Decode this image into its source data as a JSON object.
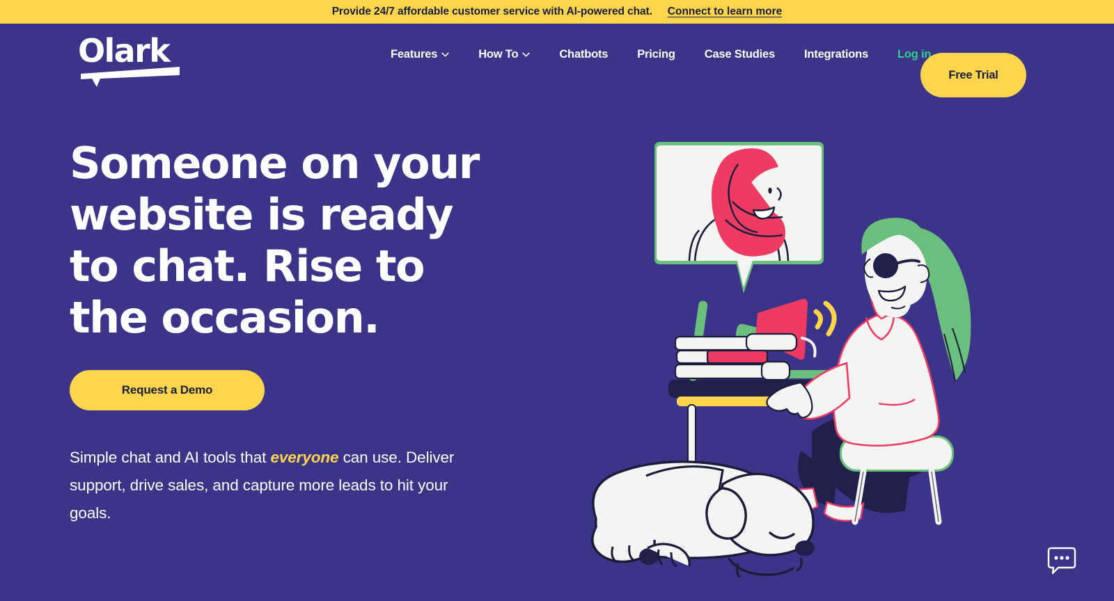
{
  "colors": {
    "background": "#3b3488",
    "accent_yellow": "#ffd54d",
    "link_green": "#2fd18a",
    "dark_navy": "#1b1b3a",
    "illus_green": "#6bbf7c",
    "illus_pink": "#ee3b63",
    "illus_white": "#f4f4f2"
  },
  "banner": {
    "message": "Provide 24/7 affordable customer service with AI-powered chat.",
    "link_label": "Connect to learn more"
  },
  "header": {
    "logo_text": "Olark",
    "nav_items": [
      {
        "label": "Features",
        "has_dropdown": true,
        "icon": "chevron-down-icon"
      },
      {
        "label": "How To",
        "has_dropdown": true,
        "icon": "chevron-down-icon"
      },
      {
        "label": "Chatbots",
        "has_dropdown": false
      },
      {
        "label": "Pricing",
        "has_dropdown": false
      },
      {
        "label": "Case Studies",
        "has_dropdown": false
      },
      {
        "label": "Integrations",
        "has_dropdown": false
      }
    ],
    "login_label": "Log in",
    "free_trial_label": "Free Trial"
  },
  "hero": {
    "headline": "Someone on your website is ready to chat. Rise to the occasion.",
    "cta_label": "Request a Demo",
    "subtext_part1": "Simple chat and AI tools that ",
    "subtext_highlight": "everyone",
    "subtext_part2": " can use. Deliver support, drive sales, and capture more leads to hit your goals."
  },
  "illustration": {
    "description": "Woman with green hair and sunglasses seated at a desk with a green laptop, megaphone, stacked books, a sleeping dog underneath, and a chat speech bubble showing a woman in a pink hijab",
    "speech_bubble_person": "woman-in-pink-hijab",
    "seated_person": "woman-with-green-hair-and-sunglasses",
    "desk_items": [
      "green-laptop",
      "megaphone",
      "stacked-books"
    ],
    "pet": "sleeping-dog"
  },
  "chat_widget": {
    "icon": "chat-bubble-icon"
  }
}
